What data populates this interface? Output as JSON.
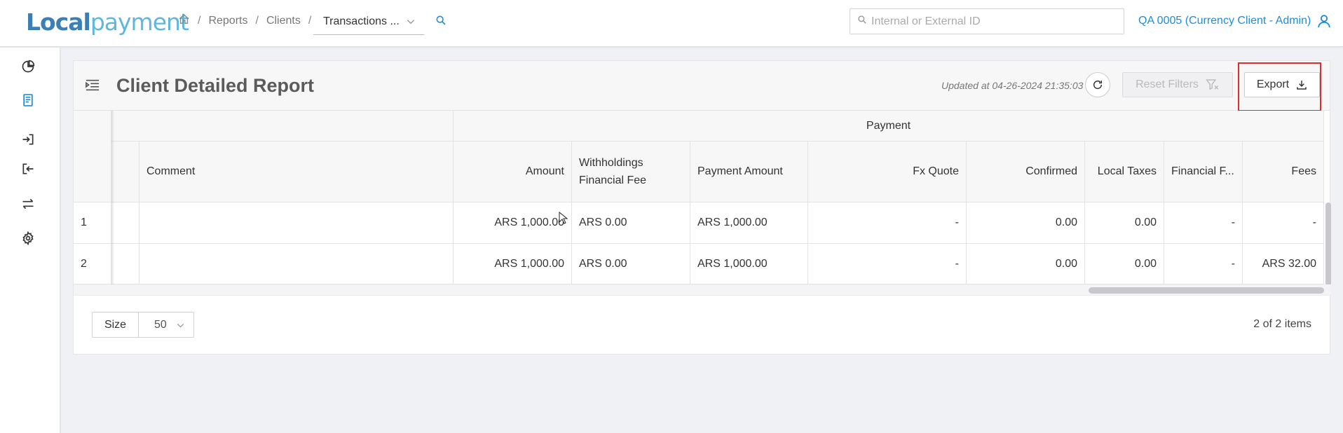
{
  "header": {
    "logo_bold": "Local",
    "logo_light": "payment",
    "breadcrumbs": [
      "Reports",
      "Clients"
    ],
    "breadcrumb_select": "Transactions ...",
    "search_placeholder": "Internal or External ID",
    "user_label": "QA 0005 (Currency Client - Admin)"
  },
  "sidebar": {
    "items": [
      {
        "icon": "pie-chart-icon"
      },
      {
        "icon": "report-icon",
        "active": true
      },
      {
        "icon": "sign-in-icon"
      },
      {
        "icon": "sign-out-icon"
      },
      {
        "icon": "transfer-icon"
      },
      {
        "icon": "gear-icon"
      }
    ]
  },
  "panel": {
    "title": "Client Detailed Report",
    "updated": "Updated at 04-26-2024 21:35:03",
    "reset_label": "Reset Filters",
    "export_label": "Export"
  },
  "table": {
    "group_header": "Payment",
    "columns": [
      "Comment",
      "Amount",
      "Withholdings Financial Fee",
      "Payment Amount",
      "Fx Quote",
      "Confirmed",
      "Local Taxes",
      "Financial F...",
      "Fees"
    ],
    "rows": [
      {
        "index": "1",
        "comment": "",
        "amount": "ARS 1,000.00",
        "withholdings": "ARS 0.00",
        "payment_amount": "ARS 1,000.00",
        "fx_quote": "-",
        "confirmed": "0.00",
        "local_taxes": "0.00",
        "financial": "-",
        "fees": "-"
      },
      {
        "index": "2",
        "comment": "",
        "amount": "ARS 1,000.00",
        "withholdings": "ARS 0.00",
        "payment_amount": "ARS 1,000.00",
        "fx_quote": "-",
        "confirmed": "0.00",
        "local_taxes": "0.00",
        "financial": "-",
        "fees": "ARS 32.00"
      }
    ]
  },
  "footer": {
    "size_label": "Size",
    "size_value": "50",
    "items_count": "2 of 2 items"
  },
  "colors": {
    "accent": "#1d8ddb",
    "highlight": "#e32b2b"
  }
}
